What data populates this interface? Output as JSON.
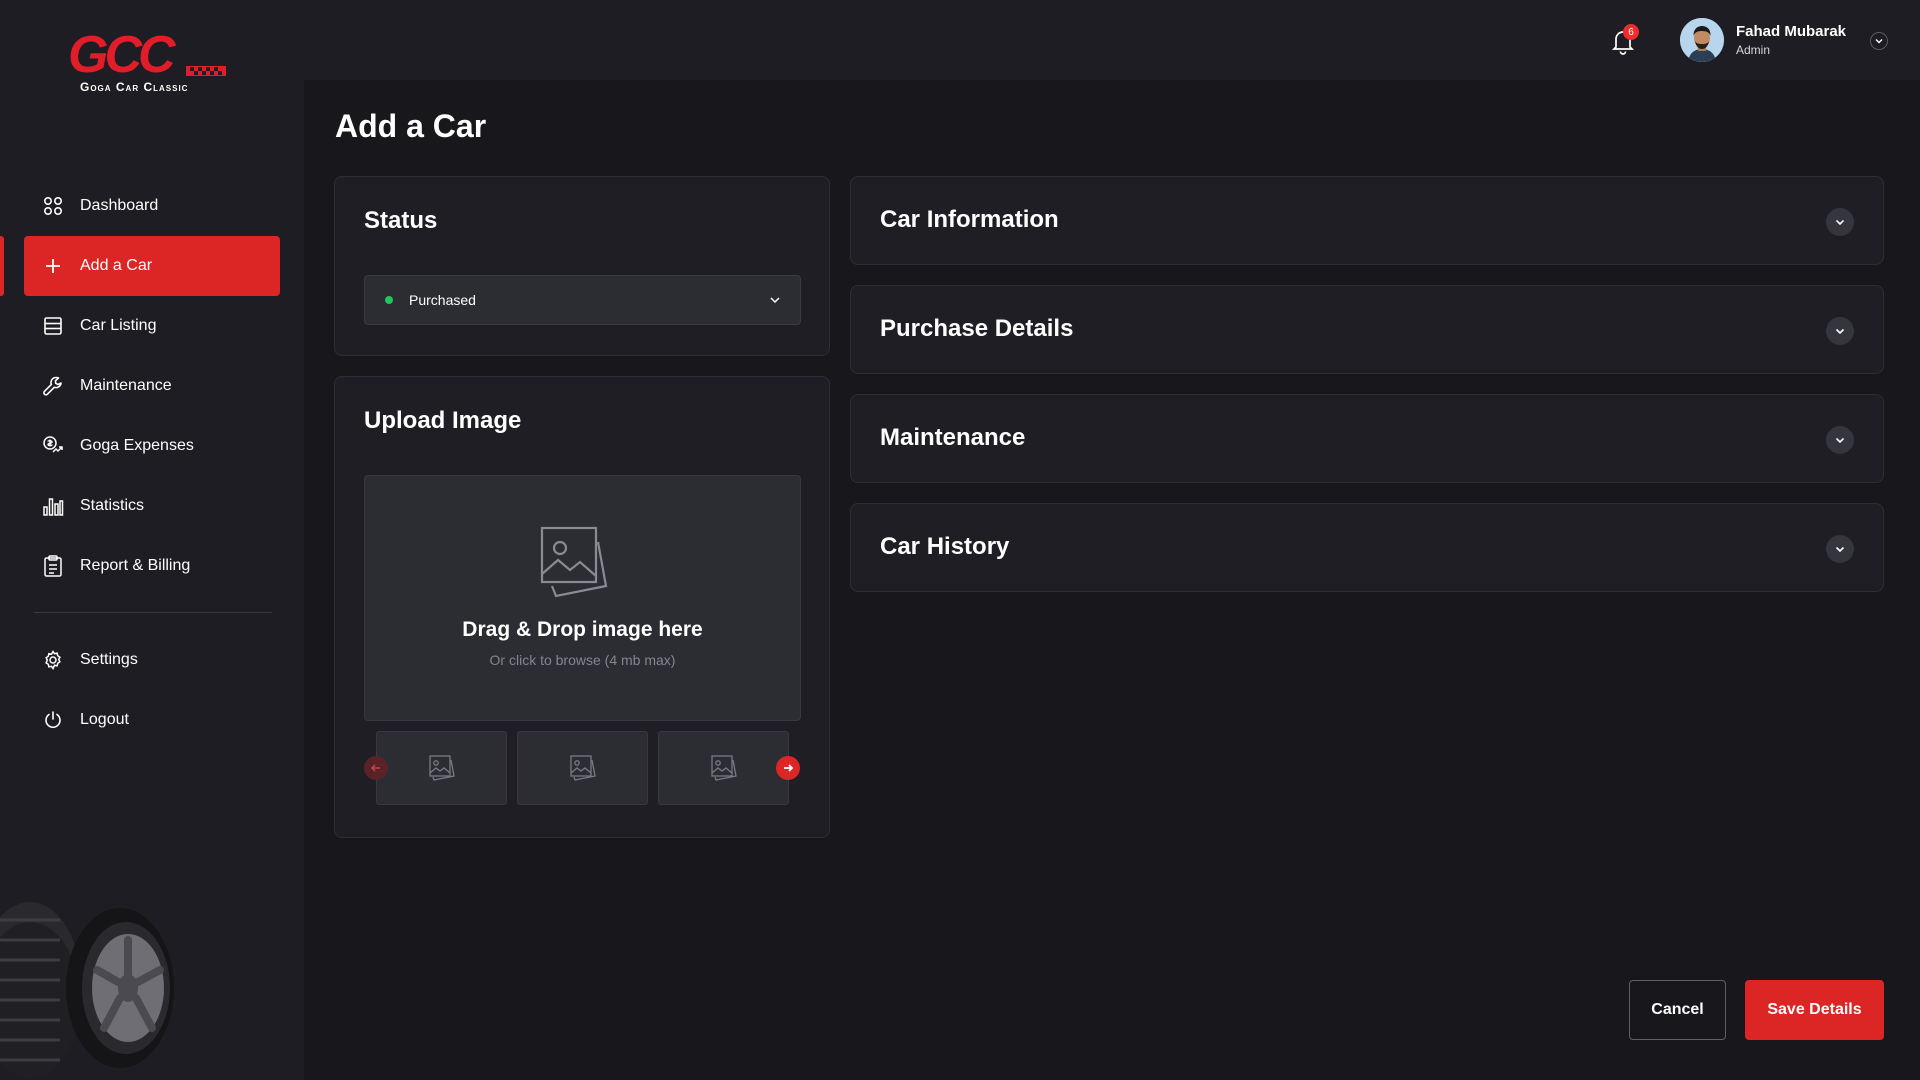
{
  "brand": {
    "logo_text": "GCC",
    "tagline": "Goga Car Classic",
    "accent": "#dc2626"
  },
  "sidebar": {
    "items": [
      {
        "label": "Dashboard",
        "icon": "dashboard-grid-icon",
        "active": false
      },
      {
        "label": "Add a Car",
        "icon": "plus-icon",
        "active": true
      },
      {
        "label": "Car Listing",
        "icon": "list-icon",
        "active": false
      },
      {
        "label": "Maintenance",
        "icon": "wrench-icon",
        "active": false
      },
      {
        "label": "Goga Expenses",
        "icon": "expenses-icon",
        "active": false
      },
      {
        "label": "Statistics",
        "icon": "bar-chart-icon",
        "active": false
      },
      {
        "label": "Report & Billing",
        "icon": "clipboard-icon",
        "active": false
      }
    ],
    "bottom_items": [
      {
        "label": "Settings",
        "icon": "gear-icon"
      },
      {
        "label": "Logout",
        "icon": "power-icon"
      }
    ]
  },
  "header": {
    "notifications_count": "6",
    "user": {
      "name": "Fahad Mubarak",
      "role": "Admin"
    }
  },
  "page": {
    "title": "Add a Car"
  },
  "status_card": {
    "title": "Status",
    "selected": "Purchased",
    "status_color": "#22c55e"
  },
  "upload_card": {
    "title": "Upload Image",
    "drop_title": "Drag & Drop image here",
    "drop_subtitle": "Or click to browse (4 mb max)"
  },
  "sections": [
    {
      "title": "Car Information"
    },
    {
      "title": "Purchase Details"
    },
    {
      "title": "Maintenance"
    },
    {
      "title": "Car History"
    }
  ],
  "actions": {
    "cancel_label": "Cancel",
    "save_label": "Save Details"
  }
}
